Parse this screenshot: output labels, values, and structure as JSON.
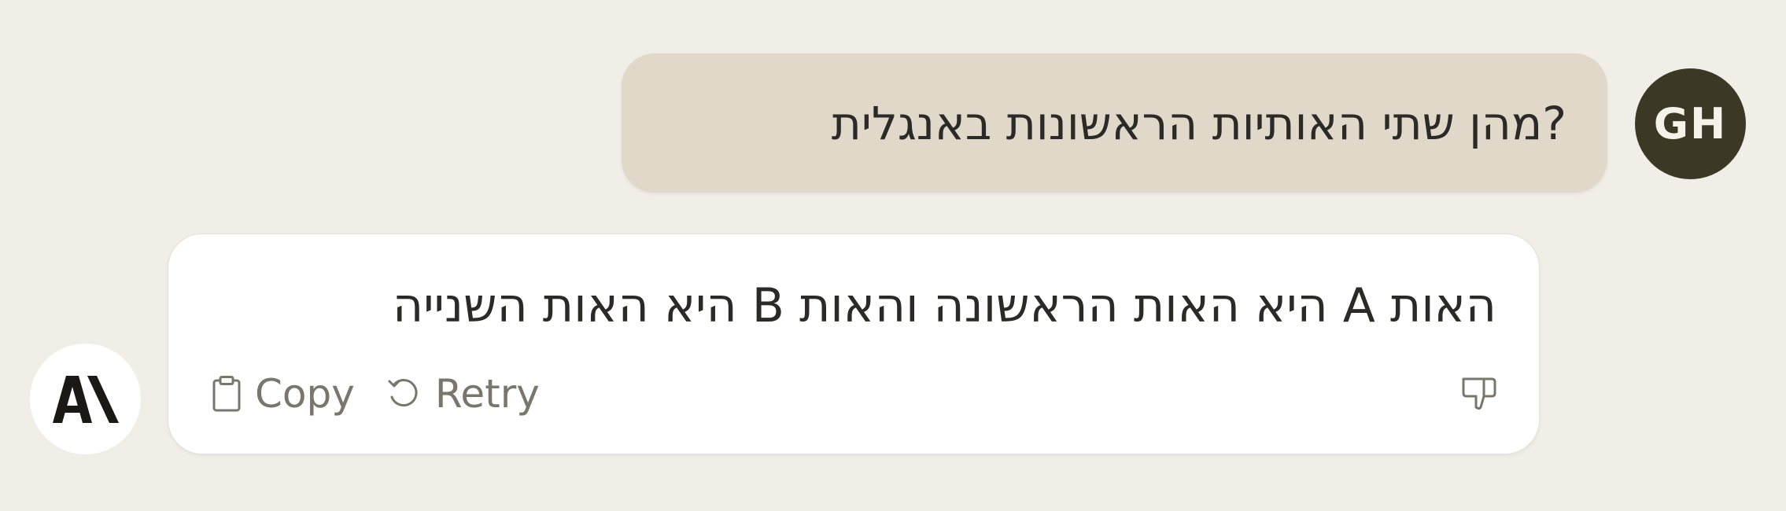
{
  "user_message": {
    "avatar_initials": "GH",
    "text": "?מהן שתי האותיות הראשונות באנגלית"
  },
  "assistant_message": {
    "avatar_icon": "anthropic-logo-icon",
    "avatar_logo_text": "A\\",
    "text": "האות A היא האות הראשונה והאות B היא האות השנייה",
    "actions": {
      "copy_label": "Copy",
      "copy_icon": "clipboard-icon",
      "retry_label": "Retry",
      "retry_icon": "retry-icon",
      "feedback_icon": "thumbs-down-icon"
    }
  },
  "colors": {
    "background": "#f0eee6",
    "user_bubble": "#e0d8c9",
    "user_avatar": "#3b3826",
    "assistant_bubble": "#ffffff",
    "muted_text": "#7a766c"
  }
}
